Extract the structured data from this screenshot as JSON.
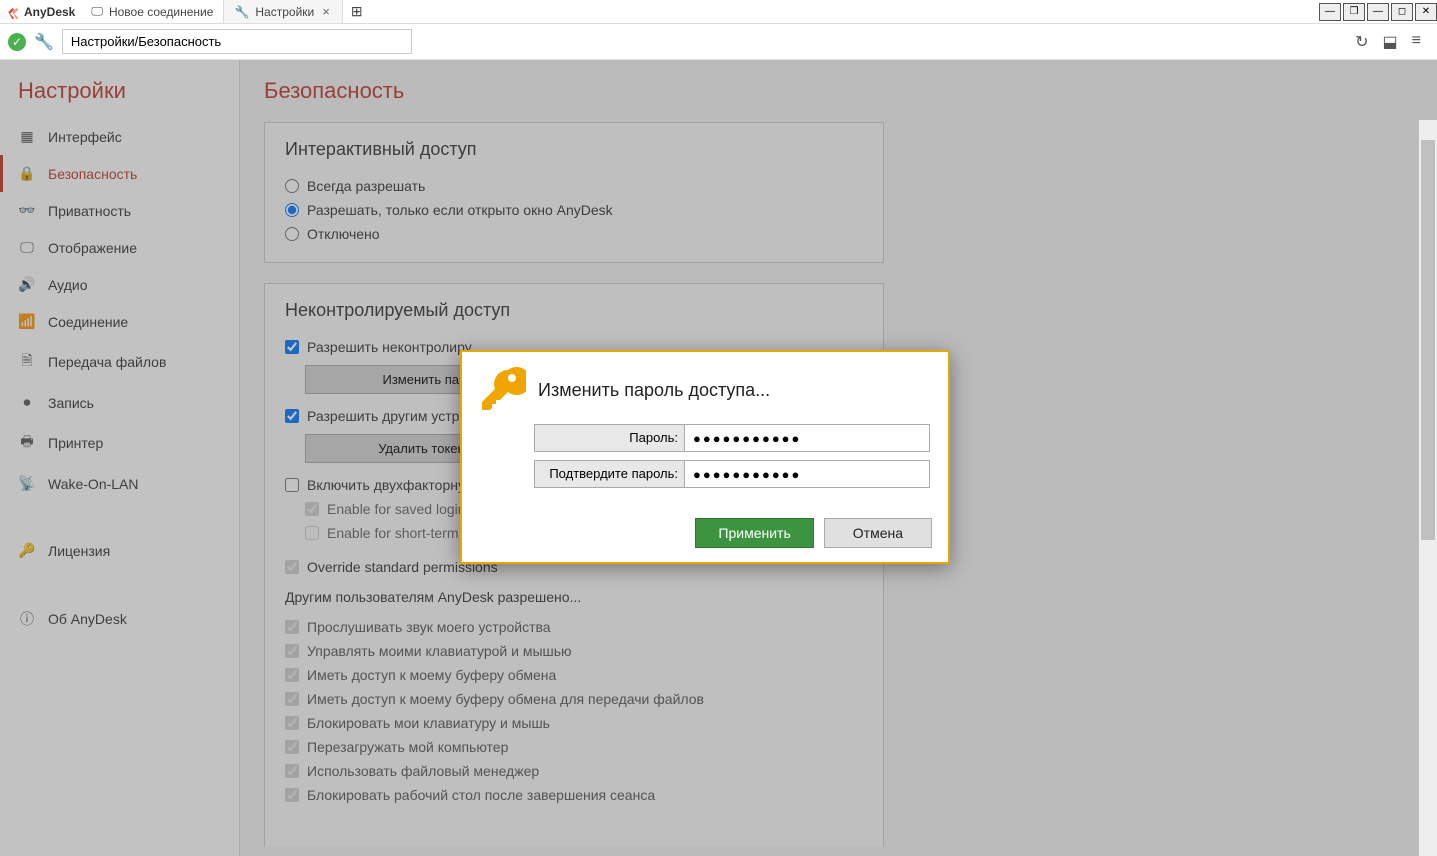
{
  "app": {
    "name": "AnyDesk"
  },
  "tabs": {
    "t0": "Новое соединение",
    "t1": "Настройки"
  },
  "addr": {
    "path": "Настройки/Безопасность"
  },
  "sidebar": {
    "title": "Настройки",
    "items": [
      {
        "label": "Интерфейс"
      },
      {
        "label": "Безопасность"
      },
      {
        "label": "Приватность"
      },
      {
        "label": "Отображение"
      },
      {
        "label": "Аудио"
      },
      {
        "label": "Соединение"
      },
      {
        "label": "Передача файлов"
      },
      {
        "label": "Запись"
      },
      {
        "label": "Принтер"
      },
      {
        "label": "Wake-On-LAN"
      },
      {
        "label": "Лицензия"
      },
      {
        "label": "Об AnyDesk"
      }
    ]
  },
  "page": {
    "title": "Безопасность",
    "panel1": {
      "title": "Интерактивный доступ",
      "r0": "Всегда разрешать",
      "r1": "Разрешать, только если открыто окно AnyDesk",
      "r2": "Отключено"
    },
    "panel2": {
      "title": "Неконтролируемый доступ",
      "c0": "Разрешить неконтролиру",
      "btn0": "Изменить пароль ",
      "c1": "Разрешить другим устро",
      "btn1": "Удалить токены ав",
      "c2": "Включить двухфакторну",
      "c3": "Enable for saved login ",
      "c4": "Enable for short-term passwords (e.g. remote restart)",
      "c5": "Override standard permissions",
      "permtext": "Другим пользователям AnyDesk разрешено...",
      "p0": "Прослушивать звук моего устройства",
      "p1": "Управлять моими клавиатурой и мышью",
      "p2": "Иметь доступ к моему буферу обмена",
      "p3": "Иметь доступ к моему буферу обмена для передачи файлов",
      "p4": "Блокировать мои клавиатуру и мышь",
      "p5": "Перезагружать мой компьютер",
      "p6": "Использовать файловый менеджер",
      "p7": "Блокировать рабочий стол после завершения сеанса"
    }
  },
  "modal": {
    "title": "Изменить пароль доступа...",
    "label_pw": "Пароль:",
    "label_cpw": "Подтвердите пароль:",
    "pw_value": "●●●●●●●●●●●",
    "cpw_value": "●●●●●●●●●●●",
    "apply": "Применить",
    "cancel": "Отмена"
  }
}
